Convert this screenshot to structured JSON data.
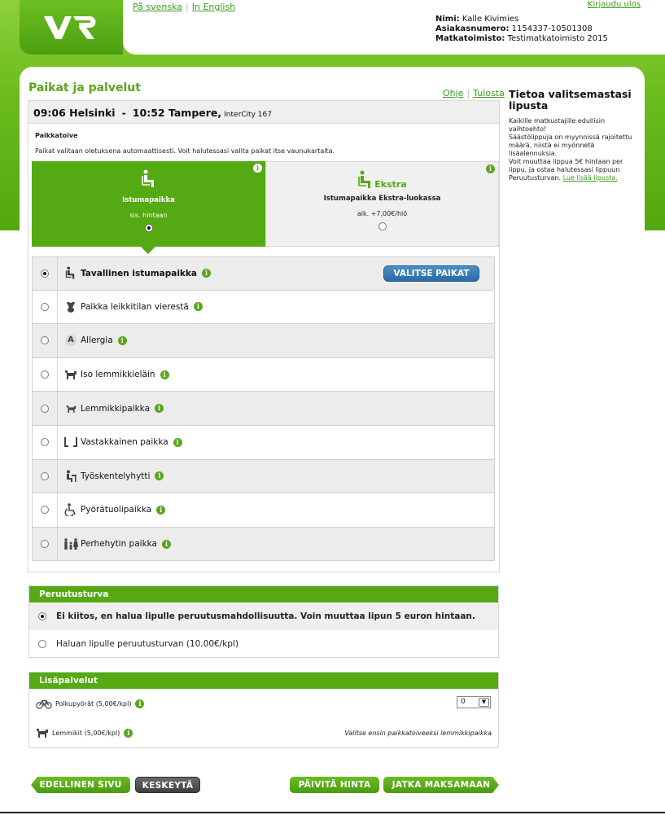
{
  "header": {
    "logo_text": "VR",
    "lang_sv": "På svenska",
    "lang_en": "In English",
    "logout": "Kirjaudu ulos",
    "user": {
      "name_label": "Nimi:",
      "name_value": "Kalle Kivimies",
      "customer_label": "Asiakasnumero:",
      "customer_value": "1154337-10501308",
      "office_label": "Matkatoimisto:",
      "office_value": "Testimatkatoimisto 2015"
    }
  },
  "page": {
    "title": "Paikat ja palvelut",
    "help": "Ohje",
    "print": "Tulosta"
  },
  "trip": {
    "depart": "09:06 Helsinki",
    "dash": "-",
    "arrive": "10:52 Tampere,",
    "train": "InterCity 167"
  },
  "seat_pref": {
    "label": "Paikkatoive",
    "text": "Paikat valitaan oletuksena automaattisesti. Voit halutessasi valita paikat itse vaunukartalta.",
    "tabs": [
      {
        "title": "Istumapaikka",
        "price": "sis. hintaan",
        "selected": true
      },
      {
        "badge": "Ekstra",
        "title": "Istumapaikka Ekstra-luokassa",
        "price": "alk.  +7,00€/hlö",
        "selected": false
      }
    ],
    "info": "i"
  },
  "options": [
    {
      "label": "Tavallinen istumapaikka",
      "icon": "seat-icon",
      "selected": true
    },
    {
      "label": "Paikka leikkitilan vierestä",
      "icon": "teddy-bear-icon",
      "selected": false
    },
    {
      "label": "Allergia",
      "icon": "allergy-icon",
      "selected": false
    },
    {
      "label": "Iso lemmikkieläin",
      "icon": "large-pet-icon",
      "selected": false
    },
    {
      "label": "Lemmikkipaikka",
      "icon": "pet-icon",
      "selected": false
    },
    {
      "label": "Vastakkainen paikka",
      "icon": "facing-seats-icon",
      "selected": false
    },
    {
      "label": "Työskentelyhytti",
      "icon": "work-cabin-icon",
      "selected": false
    },
    {
      "label": "Pyörätuolipaikka",
      "icon": "wheelchair-icon",
      "selected": false
    },
    {
      "label": "Perhehytin paikka",
      "icon": "family-icon",
      "selected": false
    }
  ],
  "choose_seats_button": "VALITSE PAIKAT",
  "allergy_glyph": "A",
  "cancellation": {
    "title": "Peruutusturva",
    "option1": "Ei kiitos, en halua lipulle peruutusmahdollisuutta. Voin muuttaa lipun 5 euron hintaan.",
    "option2": "Haluan lipulle peruutusturvan (10,00€/kpl)"
  },
  "extras": {
    "title": "Lisäpalvelut",
    "bike_label": "Polkupyörät (5,00€/kpl)",
    "bike_qty": "0",
    "pet_label": "Lemmikit (5,00€/kpl)",
    "pet_note": "Valitse ensin paikkatoiveeksi lemmikkipaikka"
  },
  "sidebar": {
    "title": "Tietoa valitsemastasi lipusta",
    "line1": "Kaikille matkustajille edullisin vaihtoehto!",
    "line2": "Säästölippuja on myynnissä rajoitettu määrä, niistä ei myönnetä lisäalennuksia.",
    "line3": "Voit muuttaa lippua 5€ hintaan per lippu, ja ostaa halutessasi lippuun Peruutusturvan.",
    "link": "Lue lisää lipusta."
  },
  "buttons": {
    "previous": "EDELLINEN SIVU",
    "cancel": "KESKEYTÄ",
    "update_price": "PÄIVITÄ HINTA",
    "continue": "JATKA MAKSAMAAN"
  },
  "colors": {
    "brand_green": "#55a912",
    "button_blue": "#2a6aa8"
  }
}
